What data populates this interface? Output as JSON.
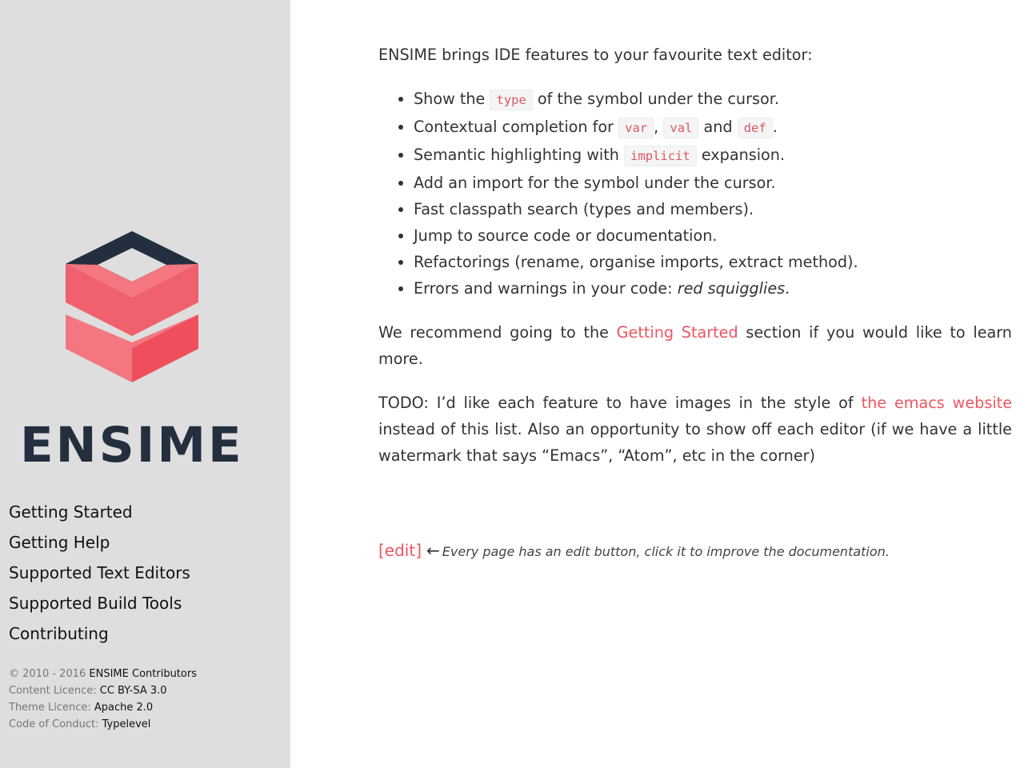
{
  "brand": {
    "name": "ENSIME",
    "colors": {
      "dark": "#232e3f",
      "coral": "#f1606d",
      "coral_light": "#f37680",
      "link": "#ee5560"
    }
  },
  "sidebar": {
    "nav": [
      {
        "label": "Getting Started"
      },
      {
        "label": "Getting Help"
      },
      {
        "label": "Supported Text Editors"
      },
      {
        "label": "Supported Build Tools"
      },
      {
        "label": "Contributing"
      }
    ],
    "footer": {
      "copyright_prefix": "© 2010 - 2016",
      "copyright_holder": "ENSIME Contributors",
      "content_licence_label": "Content Licence:",
      "content_licence_value": "CC BY-SA 3.0",
      "theme_licence_label": "Theme Licence:",
      "theme_licence_value": "Apache 2.0",
      "conduct_label": "Code of Conduct:",
      "conduct_value": "Typelevel"
    }
  },
  "main": {
    "intro": "ENSIME brings IDE features to your favourite text editor:",
    "features": {
      "f1_pre": "Show the",
      "f1_code": "type",
      "f1_post": "of the symbol under the cursor.",
      "f2_pre": "Contextual completion for",
      "f2_code1": "var",
      "f2_sep": ",",
      "f2_code2": "val",
      "f2_and": "and",
      "f2_code3": "def",
      "f2_end": ".",
      "f3_pre": "Semantic highlighting with",
      "f3_code": "implicit",
      "f3_post": "expansion.",
      "f4": "Add an import for the symbol under the cursor.",
      "f5": "Fast classpath search (types and members).",
      "f6": "Jump to source code or documentation.",
      "f7": "Refactorings (rename, organise imports, extract method).",
      "f8_pre": "Errors and warnings in your code:",
      "f8_em": "red squigglies",
      "f8_end": "."
    },
    "recommend": {
      "pre": "We recommend going to the",
      "link": "Getting Started",
      "post": "section if you would like to learn more."
    },
    "todo": {
      "pre": "TODO: I’d like each feature to have images in the style of",
      "link": "the emacs website",
      "post": "instead of this list. Also an opportunity to show off each editor (if we have a little watermark that says “Emacs”, “Atom”, etc in the corner)"
    },
    "edit": {
      "link": "[edit]",
      "arrow": "←",
      "note": "Every page has an edit button, click it to improve the documentation."
    }
  }
}
